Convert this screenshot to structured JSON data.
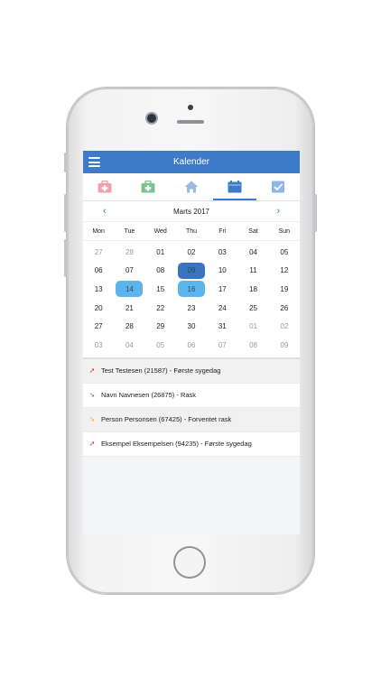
{
  "header": {
    "title": "Kalender"
  },
  "tabs": [
    {
      "name": "sick-kit",
      "color": "#f0a0ab"
    },
    {
      "name": "health-kit",
      "color": "#7cc48c"
    },
    {
      "name": "home",
      "color": "#9fb9de"
    },
    {
      "name": "calendar",
      "color": "#3e7ac7",
      "active": true
    },
    {
      "name": "checkbox",
      "color": "#8fb6e6"
    }
  ],
  "calendar": {
    "month_label": "Marts 2017",
    "prev": "‹",
    "next": "›",
    "weekdays": [
      "Mon",
      "Tue",
      "Wed",
      "Thu",
      "Fri",
      "Sat",
      "Sun"
    ],
    "days": [
      {
        "d": "27",
        "m": true
      },
      {
        "d": "28",
        "m": true
      },
      {
        "d": "01"
      },
      {
        "d": "02"
      },
      {
        "d": "03"
      },
      {
        "d": "04"
      },
      {
        "d": "05"
      },
      {
        "d": "06"
      },
      {
        "d": "07"
      },
      {
        "d": "08"
      },
      {
        "d": "09",
        "s": "today"
      },
      {
        "d": "10"
      },
      {
        "d": "11"
      },
      {
        "d": "12"
      },
      {
        "d": "13"
      },
      {
        "d": "14",
        "s": "sel"
      },
      {
        "d": "15"
      },
      {
        "d": "16",
        "s": "sel"
      },
      {
        "d": "17"
      },
      {
        "d": "18"
      },
      {
        "d": "19"
      },
      {
        "d": "20"
      },
      {
        "d": "21"
      },
      {
        "d": "22"
      },
      {
        "d": "23"
      },
      {
        "d": "24"
      },
      {
        "d": "25"
      },
      {
        "d": "26"
      },
      {
        "d": "27"
      },
      {
        "d": "28"
      },
      {
        "d": "29"
      },
      {
        "d": "30"
      },
      {
        "d": "31"
      },
      {
        "d": "01",
        "m": true
      },
      {
        "d": "02",
        "m": true
      },
      {
        "d": "03",
        "m": true
      },
      {
        "d": "04",
        "m": true
      },
      {
        "d": "05",
        "m": true
      },
      {
        "d": "06",
        "m": true
      },
      {
        "d": "07",
        "m": true
      },
      {
        "d": "08",
        "m": true
      },
      {
        "d": "09",
        "m": true
      }
    ]
  },
  "events": [
    {
      "arrow": "➚",
      "color": "#d9303a",
      "text": "Test Testesen (21587) - Første sygedag"
    },
    {
      "arrow": "➘",
      "color": "#3aa84a",
      "text": "Navn Navnesen (26875) - Rask"
    },
    {
      "arrow": "➘",
      "color": "#f0b030",
      "text": "Person Personsen (67425) - Forventet rask"
    },
    {
      "arrow": "➚",
      "color": "#d9303a",
      "text": "Eksempel Eksempelsen (94235) - Første sygedag"
    }
  ]
}
